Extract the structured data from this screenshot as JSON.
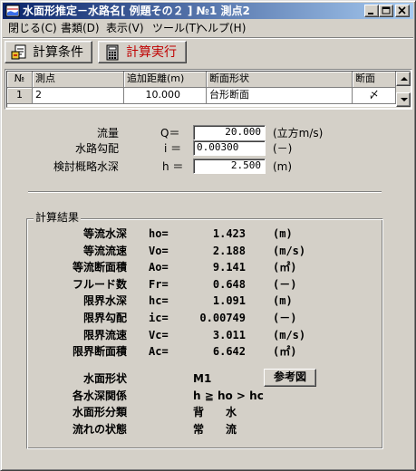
{
  "window": {
    "title": "水面形推定－水路名[ 例題その２ ] №1 測点2"
  },
  "menu": [
    {
      "label": "閉じる(C)"
    },
    {
      "label": "書類(D)"
    },
    {
      "label": "表示(V)"
    },
    {
      "label": "ツール(T)"
    },
    {
      "label": "ヘルプ(H)"
    }
  ],
  "toolbar": {
    "calc_conditions_label": "計算条件",
    "run_calc_label": "計算実行"
  },
  "grid": {
    "headers": [
      "№",
      "測点",
      "追加距離(m)",
      "断面形状",
      "断面"
    ],
    "rows": [
      {
        "no": "1",
        "station": "2",
        "distance": "10.000",
        "shape": "台形断面",
        "section": "〆"
      }
    ]
  },
  "inputs": [
    {
      "label": "流量",
      "symbol": "Q＝",
      "value": "20.000",
      "unit": "(立方m/s)"
    },
    {
      "label": "水路勾配",
      "symbol": "i ＝",
      "value": "0.00300",
      "unit": "(－)"
    },
    {
      "label": "検討概略水深",
      "symbol": "h ＝",
      "value": "2.500",
      "unit": "(m)"
    }
  ],
  "results": {
    "title": "計算結果",
    "rows": [
      {
        "label": "等流水深",
        "symbol": "ho=",
        "value": "1.423",
        "unit": "(m)"
      },
      {
        "label": "等流流速",
        "symbol": "Vo=",
        "value": "2.188",
        "unit": "(m/s)"
      },
      {
        "label": "等流断面積",
        "symbol": "Ao=",
        "value": "9.141",
        "unit": "(㎡)"
      },
      {
        "label": "フルード数",
        "symbol": "Fr=",
        "value": "0.648",
        "unit": "(－)"
      },
      {
        "label": "限界水深",
        "symbol": "hc=",
        "value": "1.091",
        "unit": "(m)"
      },
      {
        "label": "限界勾配",
        "symbol": "ic=",
        "value": "0.00749",
        "unit": "(－)"
      },
      {
        "label": "限界流速",
        "symbol": "Vc=",
        "value": "3.011",
        "unit": "(m/s)"
      },
      {
        "label": "限界断面積",
        "symbol": "Ac=",
        "value": "6.642",
        "unit": "(㎡)"
      }
    ],
    "classification": [
      {
        "label": "水面形状",
        "value": "M1"
      },
      {
        "label": "各水深関係",
        "value": "h ≧ ho > hc"
      },
      {
        "label": "水面形分類",
        "value": "背　　水"
      },
      {
        "label": "流れの状態",
        "value": "常　　流"
      }
    ],
    "ref_button_label": "参考図"
  },
  "colors": {
    "face": "#d4d0c8",
    "title_start": "#0a246a",
    "title_end": "#a6caf0",
    "run_label": "#c00000"
  }
}
